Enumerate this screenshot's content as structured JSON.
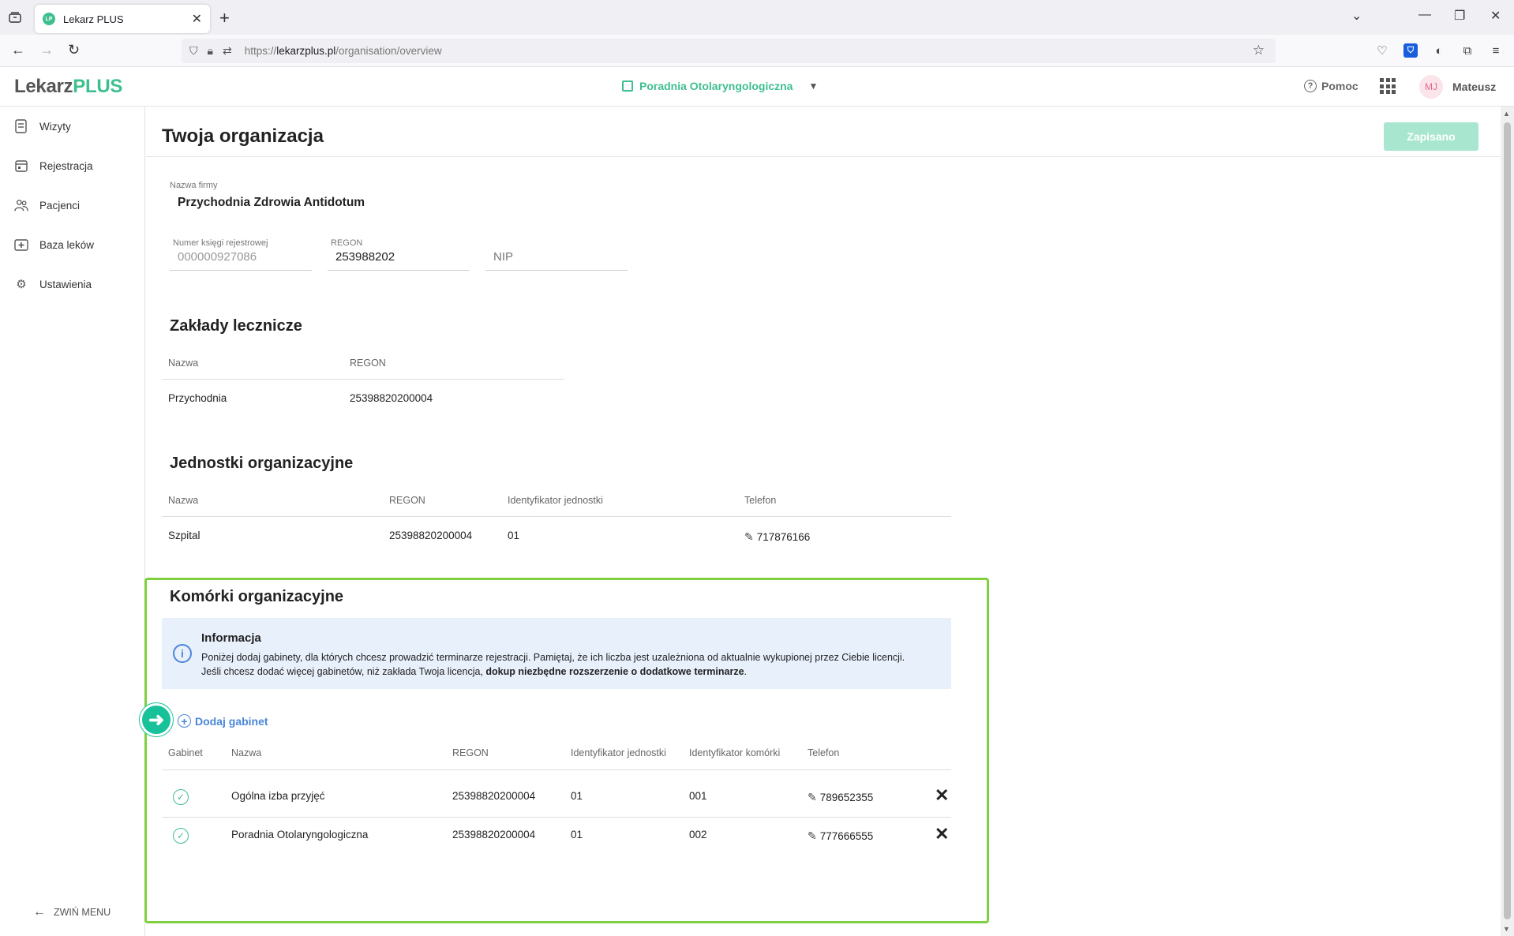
{
  "browser": {
    "tab_title": "Lekarz PLUS",
    "tab_favicon": "LP",
    "url_prefix": "https://",
    "url_host": "lekarzplus.pl",
    "url_path": "/organisation/overview"
  },
  "header": {
    "logo_main": "Lekarz",
    "logo_accent": "PLUS",
    "clinic": "Poradnia Otolaryngologiczna",
    "help": "Pomoc",
    "avatar_initials": "MJ",
    "user_name": "Mateusz"
  },
  "sidebar": {
    "items": [
      {
        "label": "Wizyty",
        "icon": "visits-icon"
      },
      {
        "label": "Rejestracja",
        "icon": "calendar-icon"
      },
      {
        "label": "Pacjenci",
        "icon": "patients-icon"
      },
      {
        "label": "Baza leków",
        "icon": "drugs-icon"
      },
      {
        "label": "Ustawienia",
        "icon": "gear-icon"
      }
    ],
    "collapse_label": "ZWIŃ MENU"
  },
  "page": {
    "title": "Twoja organizacja",
    "save_label": "Zapisano"
  },
  "company": {
    "name_label": "Nazwa firmy",
    "name_value": "Przychodnia Zdrowia Antidotum",
    "reg_label": "Numer księgi rejestrowej",
    "reg_value": "000000927086",
    "regon_label": "REGON",
    "regon_value": "253988202",
    "nip_placeholder": "NIP"
  },
  "zaklady": {
    "title": "Zakłady lecznicze",
    "headers": [
      "Nazwa",
      "REGON"
    ],
    "rows": [
      {
        "name": "Przychodnia",
        "regon": "25398820200004"
      }
    ]
  },
  "jednostki": {
    "title": "Jednostki organizacyjne",
    "headers": [
      "Nazwa",
      "REGON",
      "Identyfikator jednostki",
      "Telefon"
    ],
    "rows": [
      {
        "name": "Szpital",
        "regon": "25398820200004",
        "id": "01",
        "phone": "717876166"
      }
    ]
  },
  "komorki": {
    "title": "Komórki organizacyjne",
    "info_title": "Informacja",
    "info_line1": "Poniżej dodaj gabinety, dla których chcesz prowadzić terminarze rejestracji. Pamiętaj, że ich liczba jest uzależniona od aktualnie wykupionej przez Ciebie licencji.",
    "info_line2_plain": "Jeśli chcesz dodać więcej gabinetów, niż zakłada Twoja licencja, ",
    "info_line2_bold": "dokup niezbędne rozszerzenie o dodatkowe terminarze",
    "info_line2_end": ".",
    "add_label": "Dodaj gabinet",
    "headers": [
      "Gabinet",
      "Nazwa",
      "REGON",
      "Identyfikator jednostki",
      "Identyfikator komórki",
      "Telefon"
    ],
    "rows": [
      {
        "name": "Ogólna izba przyjęć",
        "regon": "25398820200004",
        "unit_id": "01",
        "cell_id": "001",
        "phone": "789652355"
      },
      {
        "name": "Poradnia Otolaryngologiczna",
        "regon": "25398820200004",
        "unit_id": "01",
        "cell_id": "002",
        "phone": "777666555"
      }
    ]
  },
  "colors": {
    "brand_green": "#3fbf8f",
    "highlight_border": "#7ed03f",
    "info_bg": "#e8f0fc",
    "link_blue": "#4a86d9"
  }
}
